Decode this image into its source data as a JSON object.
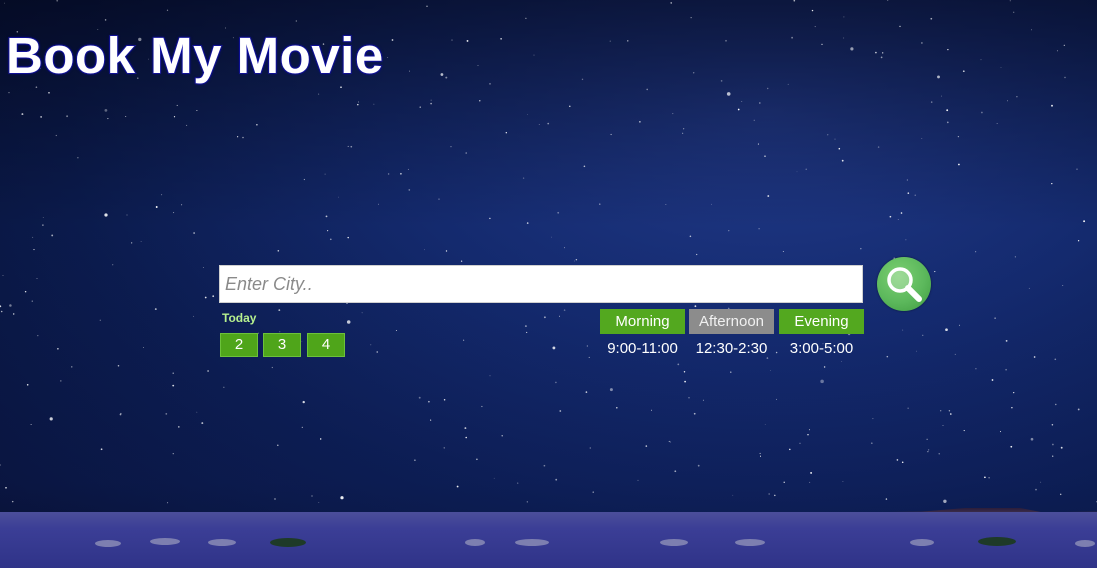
{
  "app": {
    "title": "Book My Movie"
  },
  "search": {
    "placeholder": "Enter City..",
    "value": "",
    "button_icon": "magnifier-icon"
  },
  "dates": {
    "today_label": "Today",
    "days": [
      "2",
      "3",
      "4"
    ]
  },
  "slots": [
    {
      "label": "Morning",
      "time": "9:00-11:00",
      "selected": false
    },
    {
      "label": "Afternoon",
      "time": "12:30-2:30",
      "selected": true
    },
    {
      "label": "Evening",
      "time": "3:00-5:00",
      "selected": false
    }
  ],
  "colors": {
    "accent_green": "#53a81f",
    "search_green": "#5cb85c",
    "selected_grey": "#8c8c8c",
    "title_outline": "#1a1a8c"
  }
}
